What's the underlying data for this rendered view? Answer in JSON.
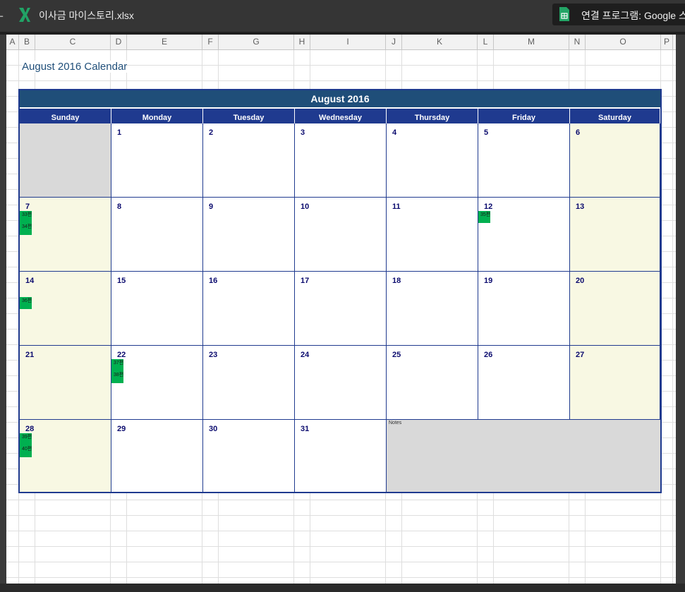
{
  "titlebar": {
    "file_name": "이사금 마이스토리.xlsx",
    "open_with_label": "연결 프로그램: Google 스"
  },
  "columns": [
    "A",
    "B",
    "C",
    "D",
    "E",
    "F",
    "G",
    "H",
    "I",
    "J",
    "K",
    "L",
    "M",
    "N",
    "O",
    "P"
  ],
  "sheet": {
    "calendar_title": "August 2016 Calendar"
  },
  "calendar": {
    "month_title": "August 2016",
    "weekdays": [
      "Sunday",
      "Monday",
      "Tuesday",
      "Wednesday",
      "Thursday",
      "Friday",
      "Saturday"
    ],
    "weeks": [
      [
        {
          "day": ""
        },
        {
          "day": "1"
        },
        {
          "day": "2"
        },
        {
          "day": "3"
        },
        {
          "day": "4"
        },
        {
          "day": "5"
        },
        {
          "day": "6"
        }
      ],
      [
        {
          "day": "7",
          "events": [
            "33편",
            "34편"
          ]
        },
        {
          "day": "8"
        },
        {
          "day": "9"
        },
        {
          "day": "10"
        },
        {
          "day": "11"
        },
        {
          "day": "12",
          "events": [
            "35편"
          ]
        },
        {
          "day": "13"
        }
      ],
      [
        {
          "day": "14",
          "events": [
            "36편"
          ]
        },
        {
          "day": "15"
        },
        {
          "day": "16"
        },
        {
          "day": "17"
        },
        {
          "day": "18"
        },
        {
          "day": "19"
        },
        {
          "day": "20"
        }
      ],
      [
        {
          "day": "21"
        },
        {
          "day": "22",
          "events": [
            "37편",
            "38편"
          ]
        },
        {
          "day": "23"
        },
        {
          "day": "24"
        },
        {
          "day": "25"
        },
        {
          "day": "26"
        },
        {
          "day": "27"
        }
      ],
      [
        {
          "day": "28",
          "events": [
            "39편",
            "40편"
          ]
        },
        {
          "day": "29"
        },
        {
          "day": "30"
        },
        {
          "day": "31"
        }
      ]
    ],
    "notes_label": "Notes"
  },
  "colors": {
    "header_dark": "#1f4e79",
    "weekday_bar": "#1f3a8f",
    "event_green": "#00b050",
    "weekend_fill": "#f8f8e3",
    "blank_fill": "#d9d9d9"
  }
}
